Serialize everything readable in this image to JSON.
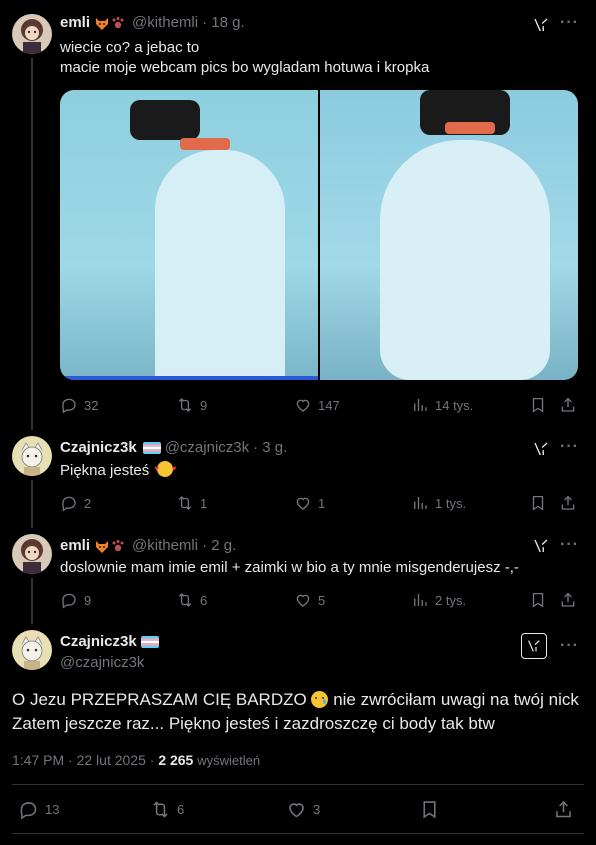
{
  "tweets": [
    {
      "name": "emli",
      "handle": "@kithemli",
      "time": "· 18 g.",
      "lines": [
        "wiecie co? a jebac to",
        "macie moje webcam pics bo wygladam hotuwa i kropka"
      ],
      "replies": "32",
      "reposts": "9",
      "likes": "147",
      "views": "14 tys."
    },
    {
      "name": "Czajnicz3k",
      "handle": "@czajnicz3k",
      "time": "· 3 g.",
      "lines": [
        "Piękna jesteś"
      ],
      "replies": "2",
      "reposts": "1",
      "likes": "1",
      "views": "1 tys."
    },
    {
      "name": "emli",
      "handle": "@kithemli",
      "time": "· 2 g.",
      "lines": [
        "doslownie mam imie emil + zaimki w bio a ty mnie misgenderujesz -,-"
      ],
      "replies": "9",
      "reposts": "6",
      "likes": "5",
      "views": "2 tys."
    }
  ],
  "main": {
    "name": "Czajnicz3k",
    "handle": "@czajnicz3k",
    "line1a": "O Jezu PRZEPRASZAM CIĘ BARDZO",
    "line1b": "nie zwróciłam uwagi na twój nick",
    "line2": "Zatem jeszcze raz... Piękno jesteś i zazdroszczę ci body tak btw",
    "timestamp": "1:47 PM · 22 lut 2025 ·",
    "view_count": "2 265",
    "views_label": "wyświetleń",
    "replies": "13",
    "reposts": "6",
    "likes": "3"
  },
  "colors": {
    "background": "#000000",
    "text": "#e7e9ea",
    "muted": "#71767b",
    "divider": "#2f3336"
  }
}
